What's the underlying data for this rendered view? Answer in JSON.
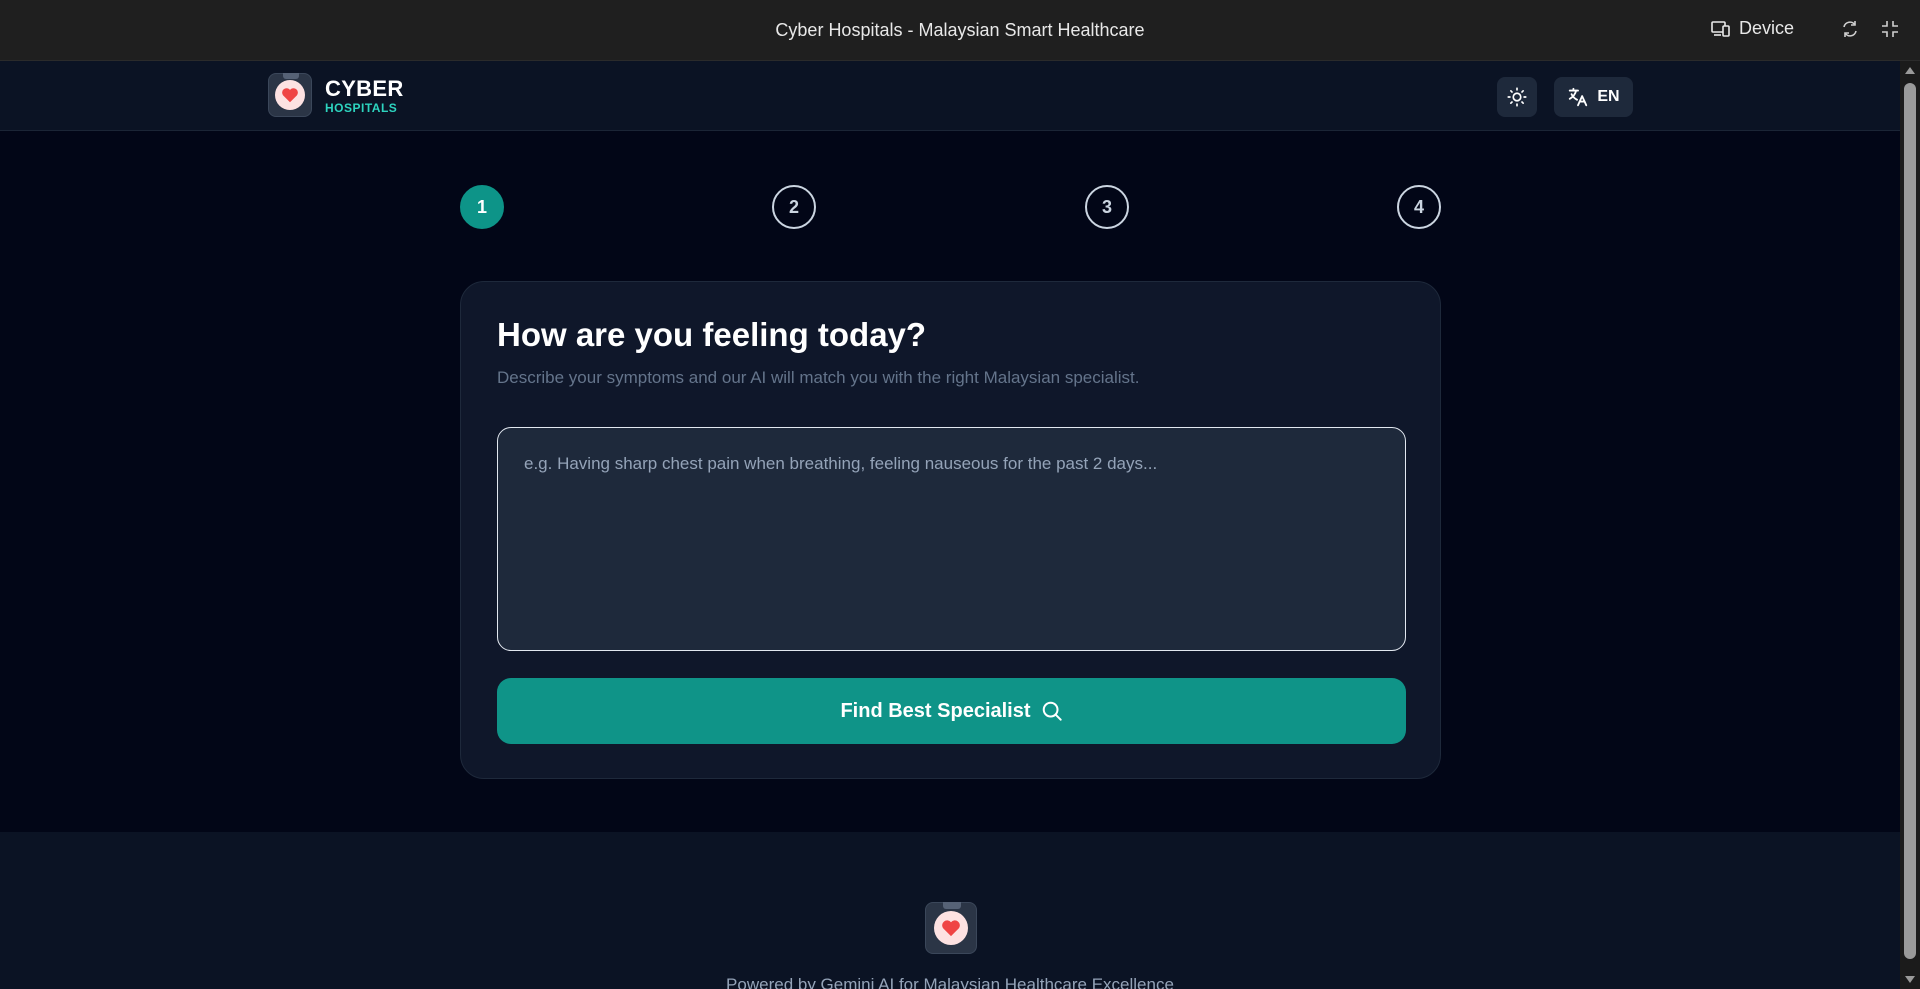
{
  "window": {
    "title": "Cyber Hospitals - Malaysian Smart Healthcare",
    "device_label": "Device",
    "icons": [
      "device-icon",
      "rotate-icon",
      "fullscreen-icon"
    ]
  },
  "header": {
    "brand_primary": "CYBER",
    "brand_secondary": "HOSPITALS",
    "logo_icon": "heart-icon",
    "theme_icon": "sun-icon",
    "language_icon": "translate-icon",
    "language_label": "EN"
  },
  "steps": [
    {
      "label": "1",
      "active": true
    },
    {
      "label": "2",
      "active": false
    },
    {
      "label": "3",
      "active": false
    },
    {
      "label": "4",
      "active": false
    }
  ],
  "card": {
    "title": "How are you feeling today?",
    "subtitle": "Describe your symptoms and our AI will match you with the right Malaysian specialist.",
    "symptom_value": "",
    "symptom_placeholder": "e.g. Having sharp chest pain when breathing, feeling nauseous for the past 2 days...",
    "button_label": "Find Best Specialist",
    "button_icon": "search-icon"
  },
  "footer": {
    "text": "Powered by Gemini AI for Malaysian Healthcare Excellence"
  },
  "colors": {
    "accent": "#0d9488",
    "brand_secondary": "#2dd4bf",
    "background": "#020617",
    "card": "#0f172a",
    "heart": "#ef4444"
  }
}
